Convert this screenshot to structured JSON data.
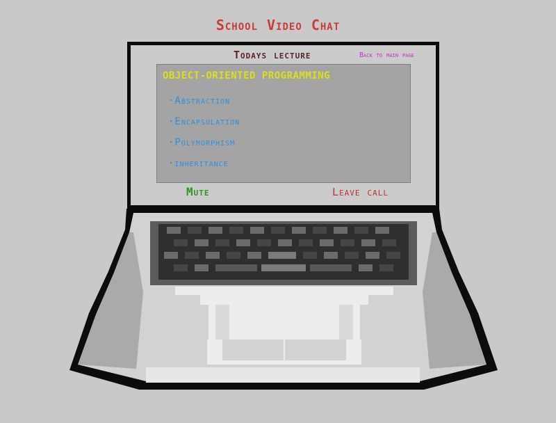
{
  "app": {
    "title": "School Video Chat"
  },
  "lecture": {
    "heading": "Todays lecture",
    "back_link": "Back to main page",
    "topic": "OBJECT-ORIENTED PROGRAMMING",
    "items": [
      "·Abstraction",
      "·Encapsulation",
      "·Polymorphism",
      "·inheritance"
    ]
  },
  "controls": {
    "mute_label": "Mute",
    "leave_label": "Leave call"
  },
  "colors": {
    "background": "#c9c9c9",
    "title": "#cc3b3b",
    "heading": "#5b2424",
    "back_link": "#cf28cf",
    "topic": "#dede1c",
    "items": "#2e8fe2",
    "mute": "#2c9622",
    "leave": "#c23131"
  },
  "icons": {
    "laptop": "pixel-laptop-icon",
    "keyboard": "pixel-keyboard-icon",
    "touchpad": "pixel-touchpad-icon"
  }
}
